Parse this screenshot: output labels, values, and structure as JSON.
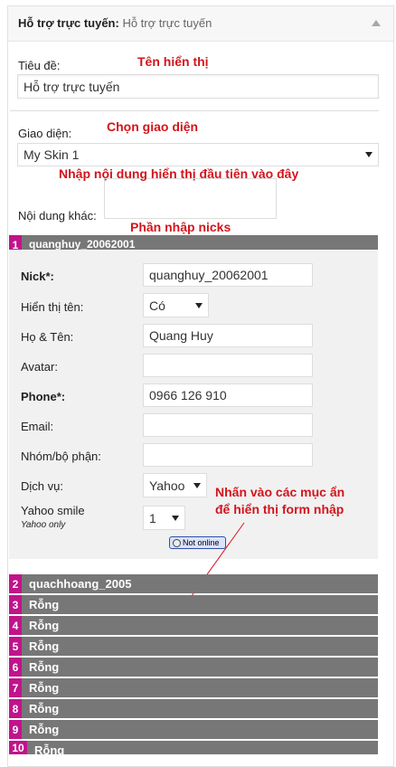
{
  "widget": {
    "title": "Hỗ trợ trực tuyến:",
    "subtitle": "Hỗ trợ trực tuyến"
  },
  "form": {
    "title_label": "Tiêu đề:",
    "title_value": "Hỗ trợ trực tuyến",
    "skin_label": "Giao diện:",
    "skin_value": "My Skin 1",
    "other_content_label": "Nội dung khác:"
  },
  "annotations": {
    "display_name": "Tên hiển thị",
    "choose_skin": "Chọn giao diện",
    "first_content": "Nhập nội dung hiển thị đầu tiên vào đây",
    "nick_section": "Phần nhập nicks",
    "click_hidden": "Nhấn vào các mục ẩn",
    "show_form": "để hiển thị form nhập"
  },
  "nick_open": {
    "number": "1",
    "name": "quanghuy_20062001",
    "fields": {
      "nick_label": "Nick*:",
      "nick_value": "quanghuy_20062001",
      "show_name_label": "Hiển thị tên:",
      "show_name_value": "Có",
      "fullname_label": "Họ & Tên:",
      "fullname_value": "Quang Huy",
      "avatar_label": "Avatar:",
      "avatar_value": "",
      "phone_label": "Phone*:",
      "phone_value": "0966 126 910",
      "email_label": "Email:",
      "email_value": "",
      "group_label": "Nhóm/bộ phận:",
      "group_value": "",
      "service_label": "Dịch vụ:",
      "service_value": "Yahoo",
      "smile_label": "Yahoo smile",
      "smile_note": "Yahoo only",
      "smile_value": "1",
      "status_text": "Not online"
    }
  },
  "nick_items": [
    {
      "number": "2",
      "name": "quachhoang_2005"
    },
    {
      "number": "3",
      "name": "Rỗng"
    },
    {
      "number": "4",
      "name": "Rỗng"
    },
    {
      "number": "5",
      "name": "Rỗng"
    },
    {
      "number": "6",
      "name": "Rỗng"
    },
    {
      "number": "7",
      "name": "Rỗng"
    },
    {
      "number": "8",
      "name": "Rỗng"
    },
    {
      "number": "9",
      "name": "Rỗng"
    },
    {
      "number": "10",
      "name": "Rỗng"
    }
  ],
  "colors": {
    "annotation": "#d3141c",
    "item_bar": "#777777",
    "number_badge": "#c0138c"
  },
  "icons": {
    "collapse": "caret-up-icon",
    "status": "yahoo-status-icon"
  }
}
